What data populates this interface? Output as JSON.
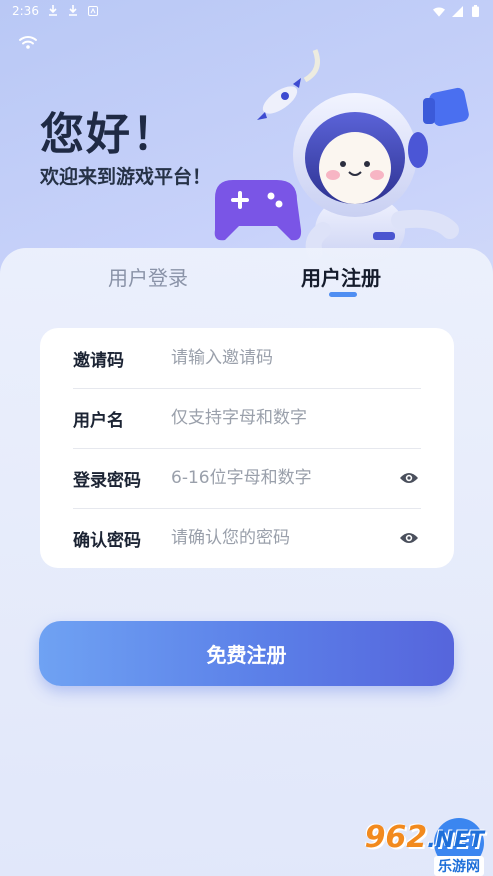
{
  "status_bar": {
    "time": "2:36",
    "left_icons": [
      "download-icon",
      "download-icon",
      "notification-icon"
    ],
    "right_icons": [
      "wifi-icon",
      "signal-icon",
      "battery-icon"
    ]
  },
  "hero": {
    "greeting": "您好！",
    "welcome": "欢迎来到游戏平台！"
  },
  "tabs": [
    {
      "label": "用户登录",
      "active": false
    },
    {
      "label": "用户注册",
      "active": true
    }
  ],
  "form": {
    "invite": {
      "label": "邀请码",
      "value": "",
      "placeholder": "请输入邀请码"
    },
    "username": {
      "label": "用户名",
      "value": "",
      "placeholder": "仅支持字母和数字"
    },
    "password": {
      "label": "登录密码",
      "value": "",
      "placeholder": "6-16位字母和数字",
      "icon": "eye-icon"
    },
    "confirm": {
      "label": "确认密码",
      "value": "",
      "placeholder": "请确认您的密码",
      "icon": "eye-icon"
    }
  },
  "submit": {
    "label": "免费注册"
  },
  "watermark": {
    "brand": "962",
    "suffix": ".NET",
    "sub": "乐游网"
  },
  "colors": {
    "accent": "#4f8ef2",
    "button_start": "#6fa2f3",
    "button_end": "#5665dc",
    "text_dark": "#1c2434",
    "text_muted": "#9aa0ab"
  }
}
